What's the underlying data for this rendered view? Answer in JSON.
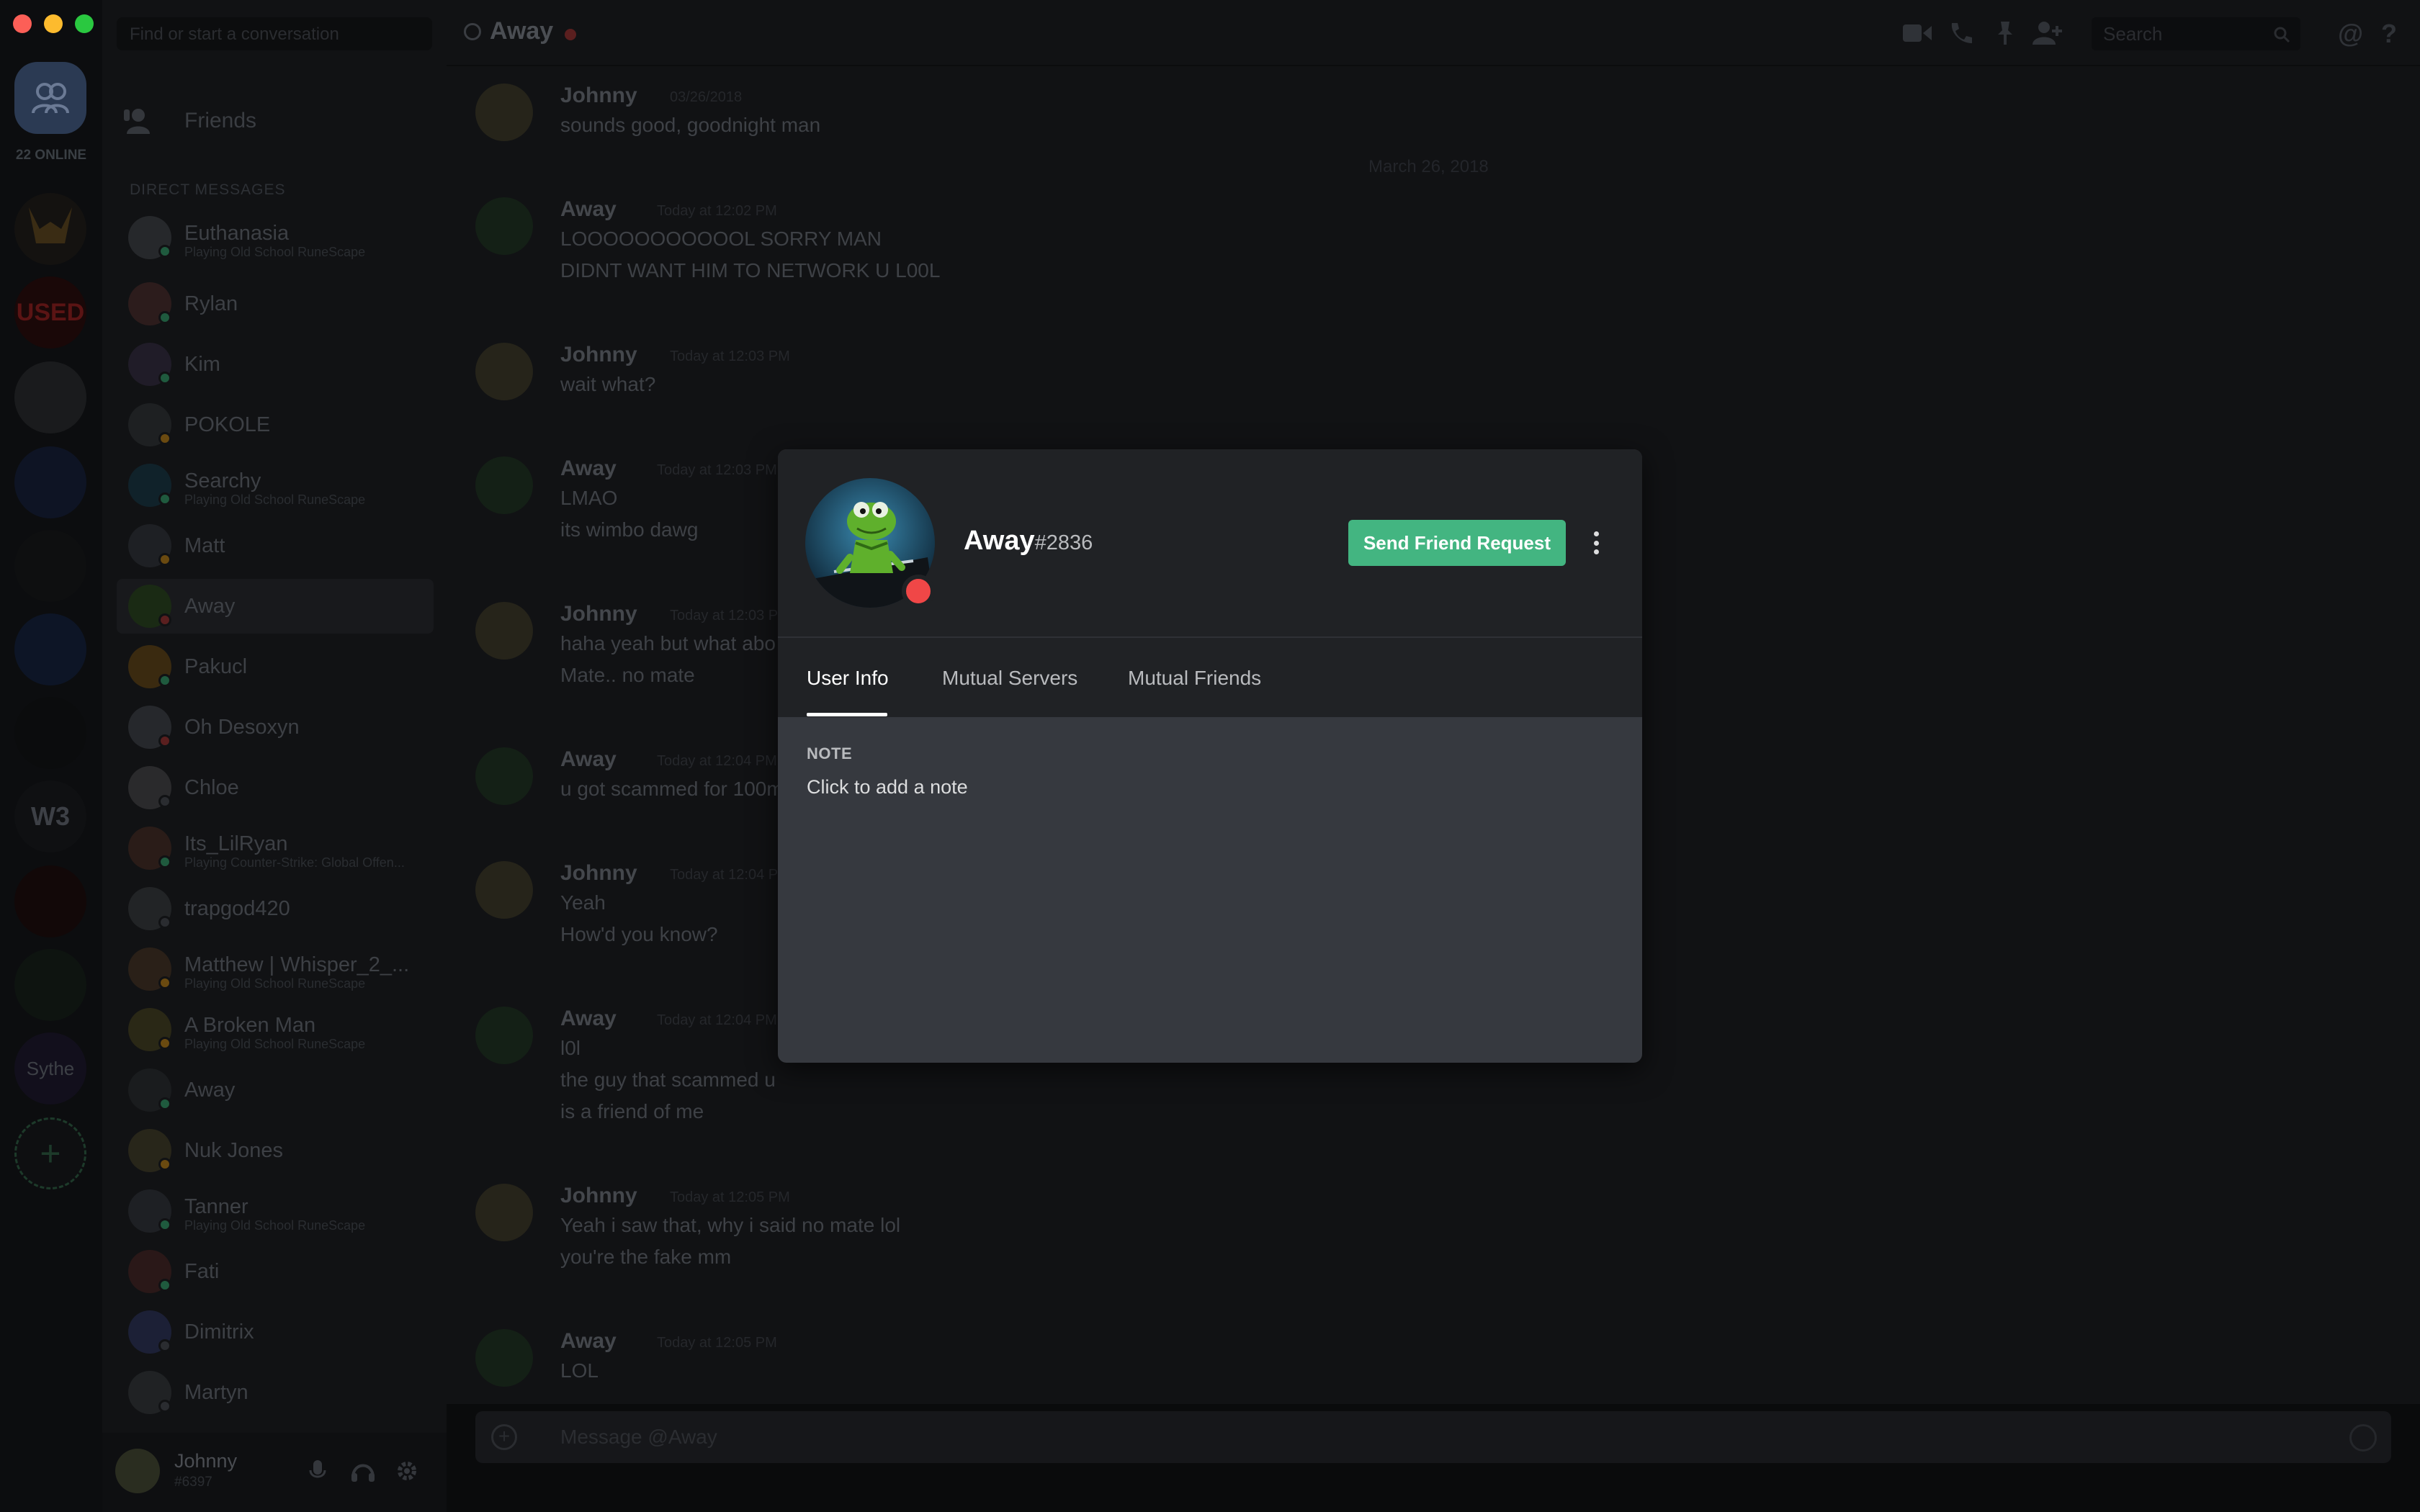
{
  "colors": {
    "accent_green": "#43b581",
    "status_dnd": "#f04747",
    "status_online": "#43b581",
    "status_idle": "#faa61a"
  },
  "server_rail": {
    "online_count": "22 ONLINE",
    "server_labels": [
      "W3",
      "Sythe"
    ]
  },
  "dm_sidebar": {
    "search_placeholder": "Find or start a conversation",
    "friends_label": "Friends",
    "section_title": "DIRECT MESSAGES",
    "items": [
      {
        "name": "Euthanasia",
        "sub": "Playing Old School RuneScape",
        "status": "online"
      },
      {
        "name": "Rylan",
        "sub": "",
        "status": "online"
      },
      {
        "name": "Kim",
        "sub": "",
        "status": "online"
      },
      {
        "name": "POKOLE",
        "sub": "",
        "status": "idle"
      },
      {
        "name": "Searchy",
        "sub": "Playing Old School RuneScape",
        "status": "online"
      },
      {
        "name": "Matt",
        "sub": "",
        "status": "idle"
      },
      {
        "name": "Away",
        "sub": "",
        "status": "dnd"
      },
      {
        "name": "Pakucl",
        "sub": "",
        "status": "online"
      },
      {
        "name": "Oh Desoxyn",
        "sub": "",
        "status": "dnd"
      },
      {
        "name": "Chloe",
        "sub": "",
        "status": "offline"
      },
      {
        "name": "Its_LilRyan",
        "sub": "Playing Counter-Strike: Global Offen...",
        "status": "online"
      },
      {
        "name": "trapgod420",
        "sub": "",
        "status": "offline"
      },
      {
        "name": "Matthew | Whisper_2_...",
        "sub": "Playing Old School RuneScape",
        "status": "idle"
      },
      {
        "name": "A Broken Man",
        "sub": "Playing Old School RuneScape",
        "status": "idle"
      },
      {
        "name": "Away",
        "sub": "",
        "status": "online"
      },
      {
        "name": "Nuk Jones",
        "sub": "",
        "status": "idle"
      },
      {
        "name": "Tanner",
        "sub": "Playing Old School RuneScape",
        "status": "online"
      },
      {
        "name": "Fati",
        "sub": "",
        "status": "online"
      },
      {
        "name": "Dimitrix",
        "sub": "",
        "status": "offline"
      },
      {
        "name": "Martyn",
        "sub": "",
        "status": "offline"
      }
    ],
    "current_user": {
      "name": "Johnny",
      "tag": "#6397"
    }
  },
  "chat_header": {
    "channel_name": "Away",
    "search_placeholder": "Search"
  },
  "chat": {
    "date_divider": "March 26, 2018",
    "messages": [
      {
        "author": "Johnny",
        "time": "03/26/2018",
        "lines": [
          "sounds good, goodnight man"
        ]
      },
      {
        "author": "Away",
        "time": "Today at 12:02 PM",
        "lines": [
          "LOOOOOOOOOOOL SORRY MAN",
          "DIDNT WANT HIM TO NETWORK U L00L"
        ]
      },
      {
        "author": "Johnny",
        "time": "Today at 12:03 PM",
        "lines": [
          "wait what?"
        ]
      },
      {
        "author": "Away",
        "time": "Today at 12:03 PM",
        "lines": [
          "LMAO",
          "its wimbo dawg"
        ]
      },
      {
        "author": "Johnny",
        "time": "Today at 12:03 PM",
        "lines": [
          "haha yeah but what abo",
          "Mate.. no mate"
        ]
      },
      {
        "author": "Away",
        "time": "Today at 12:04 PM",
        "lines": [
          "u got scammed for 100m"
        ]
      },
      {
        "author": "Johnny",
        "time": "Today at 12:04 PM",
        "lines": [
          "Yeah",
          "How'd you know?"
        ]
      },
      {
        "author": "Away",
        "time": "Today at 12:04 PM",
        "lines": [
          "l0l",
          "the guy that scammed u",
          "is a friend of me"
        ]
      },
      {
        "author": "Johnny",
        "time": "Today at 12:05 PM",
        "lines": [
          "Yeah i saw that, why i said no mate lol",
          "you're the fake mm"
        ]
      },
      {
        "author": "Away",
        "time": "Today at 12:05 PM",
        "lines": [
          "LOL"
        ]
      }
    ],
    "input_placeholder": "Message @Away"
  },
  "profile_modal": {
    "username": "Away",
    "discriminator": "#2836",
    "send_friend_request_label": "Send Friend Request",
    "tabs": [
      {
        "label": "User Info",
        "active": true
      },
      {
        "label": "Mutual Servers",
        "active": false
      },
      {
        "label": "Mutual Friends",
        "active": false
      }
    ],
    "note_title": "NOTE",
    "note_placeholder": "Click to add a note"
  }
}
